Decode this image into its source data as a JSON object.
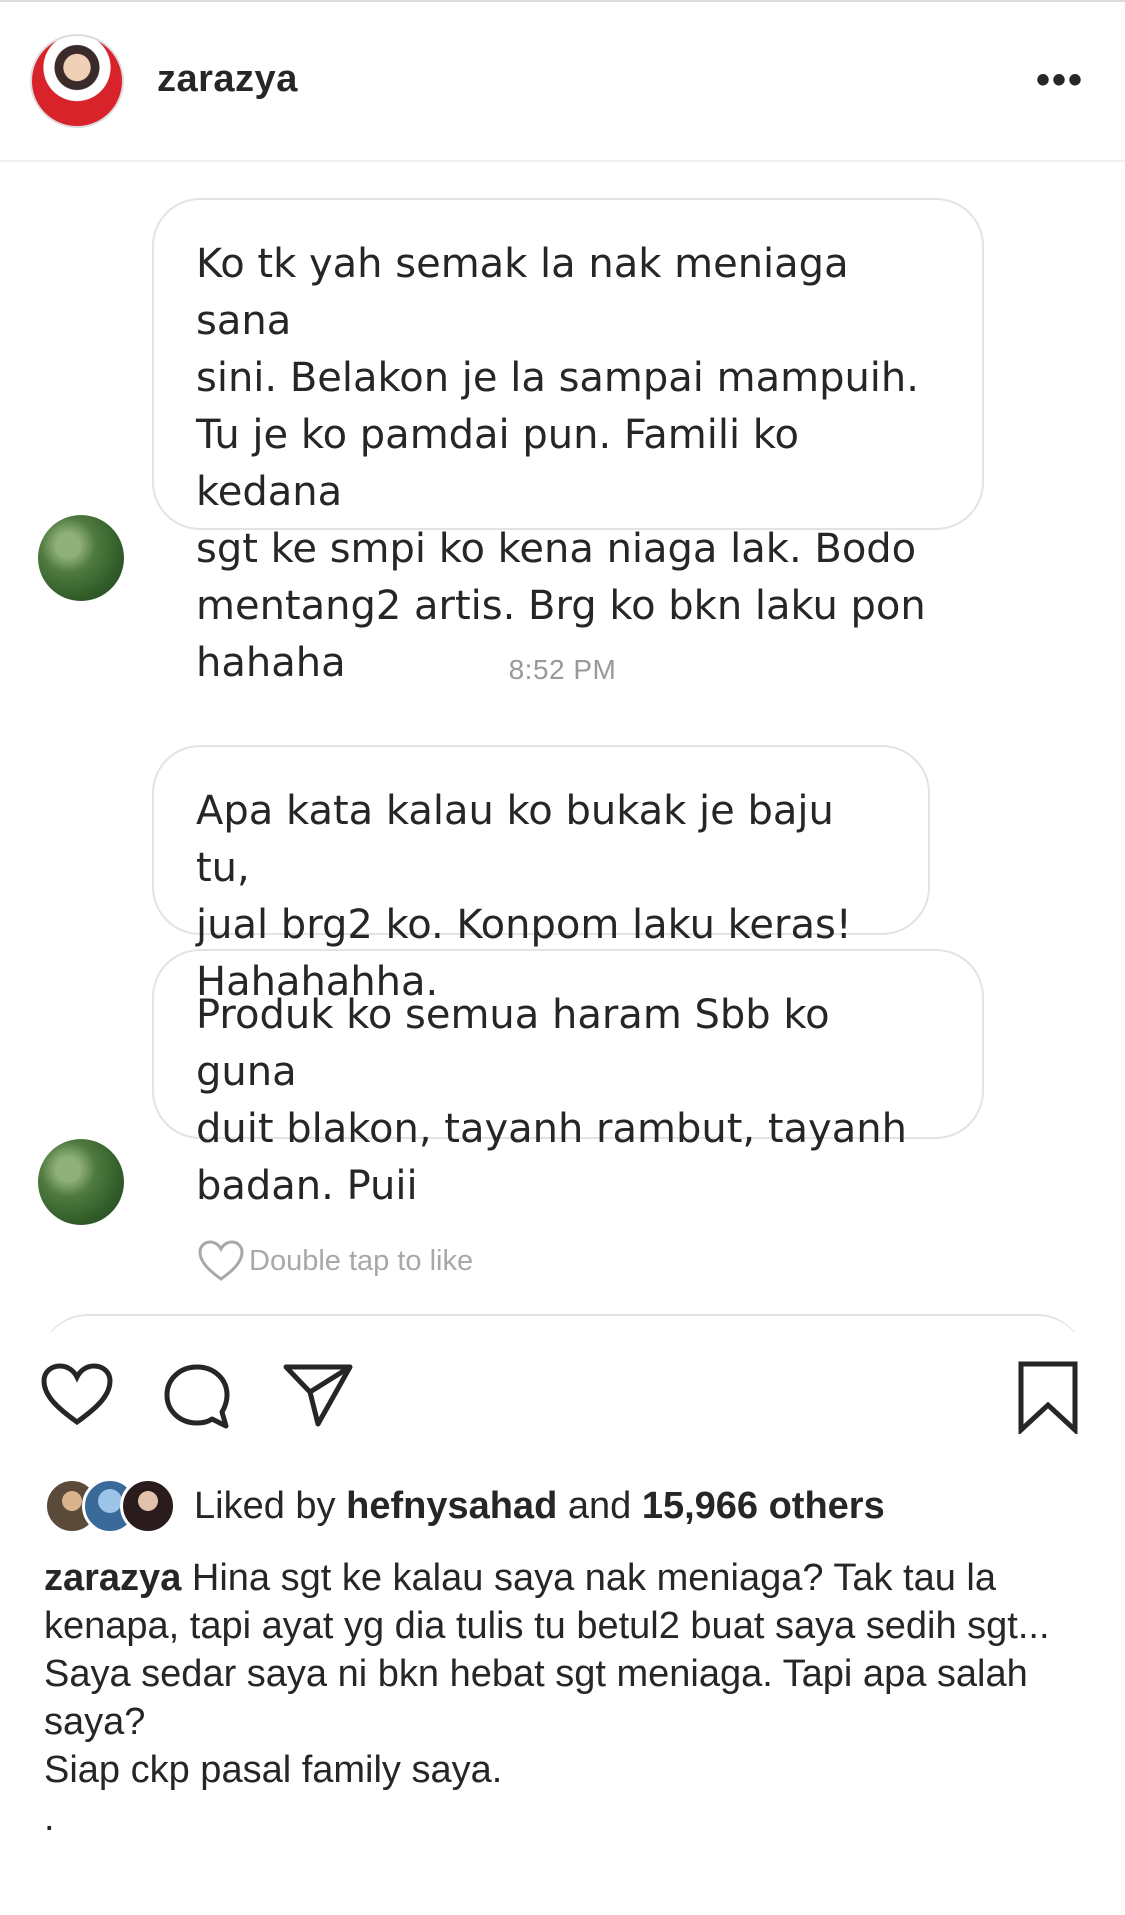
{
  "post": {
    "username": "zarazya",
    "more_label": "•••"
  },
  "dm": {
    "messages": [
      "Ko tk yah semak la nak meniaga sana\nsini. Belakon je la sampai mampuih.\nTu je ko pamdai pun. Famili ko kedana\nsgt ke smpi ko kena niaga lak. Bodo\nmentang2 artis. Brg ko bkn laku pon\nhahaha",
      "Apa kata kalau ko bukak je baju tu,\njual brg2 ko. Konpom laku keras!\nHahahahha.",
      "Produk ko semua haram Sbb ko guna\nduit blakon, tayanh rambut, tayanh\nbadan. Puii"
    ],
    "timestamp": "8:52 PM",
    "double_tap": "Double tap to like"
  },
  "likes": {
    "prefix": "Liked by",
    "user": "hefnysahad",
    "middle": "and",
    "count": "15,966 others"
  },
  "caption": {
    "username": "zarazya",
    "first_line": " Hina sgt ke kalau saya nak meniaga? Tak tau la kenapa, tapi ayat yg dia tulis tu betul2 buat saya sedih sgt...",
    "line2": "Saya sedar saya ni bkn hebat sgt meniaga. Tapi apa salah saya?",
    "line3": "Siap ckp pasal family saya.",
    "line4": "."
  },
  "icons": {
    "like": "heart-icon",
    "comment": "comment-icon",
    "share": "send-icon",
    "save": "bookmark-icon",
    "more": "more-icon"
  },
  "colors": {
    "text": "#262626",
    "muted": "#999999",
    "border": "#e3e3e3",
    "accent": "#3897f0"
  }
}
